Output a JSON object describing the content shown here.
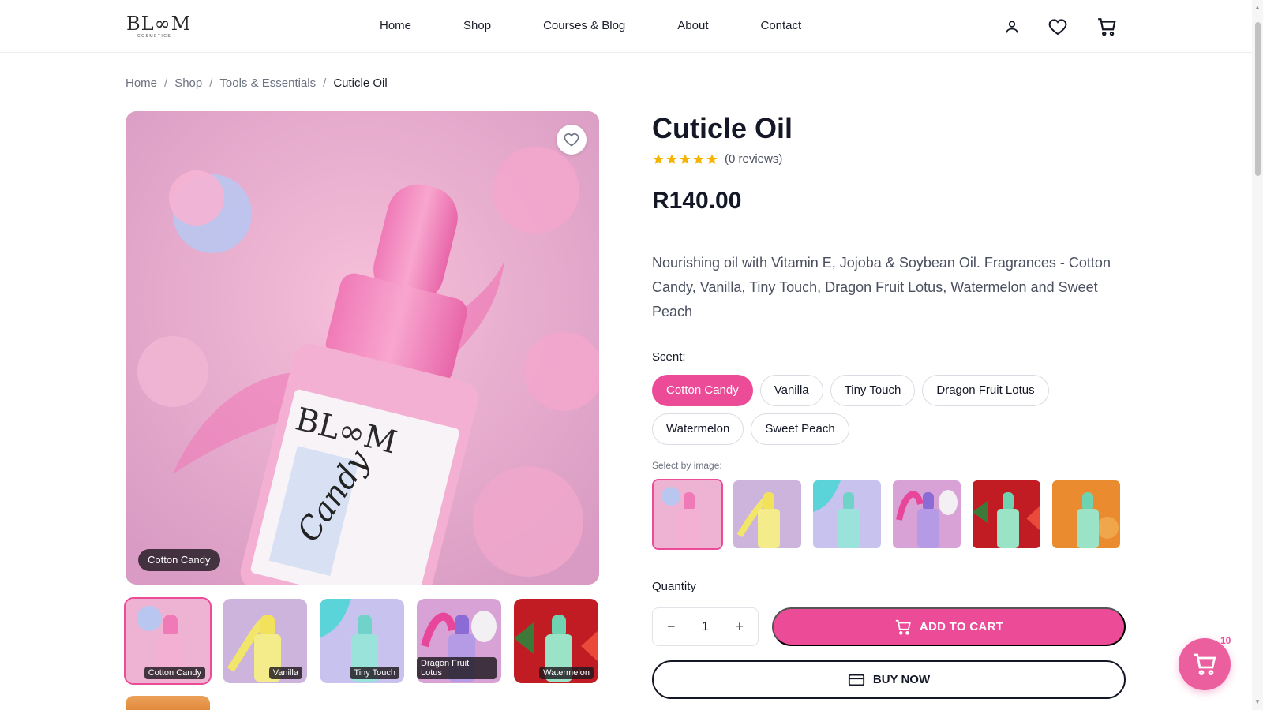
{
  "header": {
    "logo_text": "BL∞M",
    "logo_sub": "COSMETICS",
    "nav": [
      "Home",
      "Shop",
      "Courses & Blog",
      "About",
      "Contact"
    ]
  },
  "breadcrumb": {
    "items": [
      "Home",
      "Shop",
      "Tools & Essentials"
    ],
    "current": "Cuticle Oil",
    "separator": "/"
  },
  "product": {
    "title": "Cuticle Oil",
    "rating": 5,
    "reviews": "(0 reviews)",
    "price": "R140.00",
    "description": "Nourishing oil with Vitamin E, Jojoba & Soybean Oil. Fragrances - Cotton Candy, Vanilla, Tiny Touch, Dragon Fruit Lotus, Watermelon and Sweet Peach",
    "image_tag": "Cotton Candy"
  },
  "scent": {
    "label": "Scent:",
    "options": [
      "Cotton Candy",
      "Vanilla",
      "Tiny Touch",
      "Dragon Fruit Lotus",
      "Watermelon",
      "Sweet Peach"
    ],
    "selected": "Cotton Candy"
  },
  "select_by_image_label": "Select by image:",
  "thumbnails": [
    "Cotton Candy",
    "Vanilla",
    "Tiny Touch",
    "Dragon Fruit Lotus",
    "Watermelon"
  ],
  "quantity": {
    "label": "Quantity",
    "value": "1",
    "minus": "−",
    "plus": "+"
  },
  "actions": {
    "add_to_cart": "ADD TO CART",
    "buy_now": "BUY NOW"
  },
  "cart_badge": "10",
  "colors": {
    "accent": "#ec4b98",
    "text": "#141826"
  }
}
